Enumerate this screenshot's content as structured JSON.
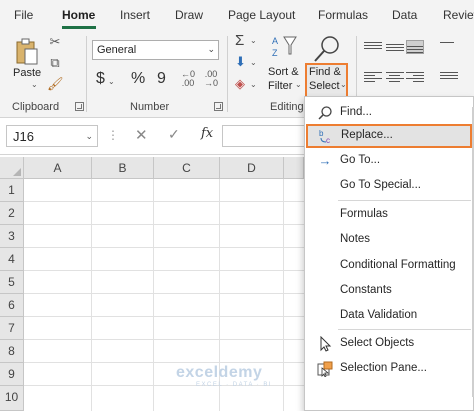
{
  "tabs": [
    "File",
    "Home",
    "Insert",
    "Draw",
    "Page Layout",
    "Formulas",
    "Data",
    "Review"
  ],
  "active_tab": "Home",
  "ribbon": {
    "clipboard": {
      "paste_label": "Paste",
      "group_label": "Clipboard"
    },
    "number": {
      "format_value": "General",
      "currency": "$",
      "comma_style": "❯",
      "percent": "%",
      "thousands": "9",
      "group_label": "Number"
    },
    "editing": {
      "sort_filter_line1": "Sort &",
      "sort_filter_line2": "Filter",
      "find_select_line1": "Find &",
      "find_select_line2": "Select",
      "group_label": "Editing"
    }
  },
  "formula_bar": {
    "name_box": "J16",
    "cancel": "✕",
    "enter": "✓",
    "fx": "fx",
    "dots": "⋮"
  },
  "grid": {
    "columns": [
      "A",
      "B",
      "C",
      "D"
    ],
    "rows": [
      "1",
      "2",
      "3",
      "4",
      "5",
      "6",
      "7",
      "8",
      "9",
      "10"
    ]
  },
  "menu": {
    "items": [
      {
        "label": "Find...",
        "icon": "search-icon",
        "highlighted": false
      },
      {
        "label": "Replace...",
        "icon": "replace-icon",
        "highlighted": true
      },
      {
        "label": "Go To...",
        "icon": "arrow-right-icon",
        "highlighted": false
      },
      {
        "label": "Go To Special...",
        "icon": "",
        "highlighted": false
      },
      {
        "label": "Formulas",
        "icon": "",
        "highlighted": false
      },
      {
        "label": "Notes",
        "icon": "",
        "highlighted": false
      },
      {
        "label": "Conditional Formatting",
        "icon": "",
        "highlighted": false
      },
      {
        "label": "Constants",
        "icon": "",
        "highlighted": false
      },
      {
        "label": "Data Validation",
        "icon": "",
        "highlighted": false
      },
      {
        "label": "Select Objects",
        "icon": "pointer-icon",
        "highlighted": false
      },
      {
        "label": "Selection Pane...",
        "icon": "selection-pane-icon",
        "highlighted": false
      }
    ]
  },
  "watermark": {
    "name": "exceldemy",
    "tagline": "EXCEL · DATA · BI"
  },
  "colors": {
    "accent_green": "#1e7145",
    "highlight_orange": "#ed7d31"
  }
}
